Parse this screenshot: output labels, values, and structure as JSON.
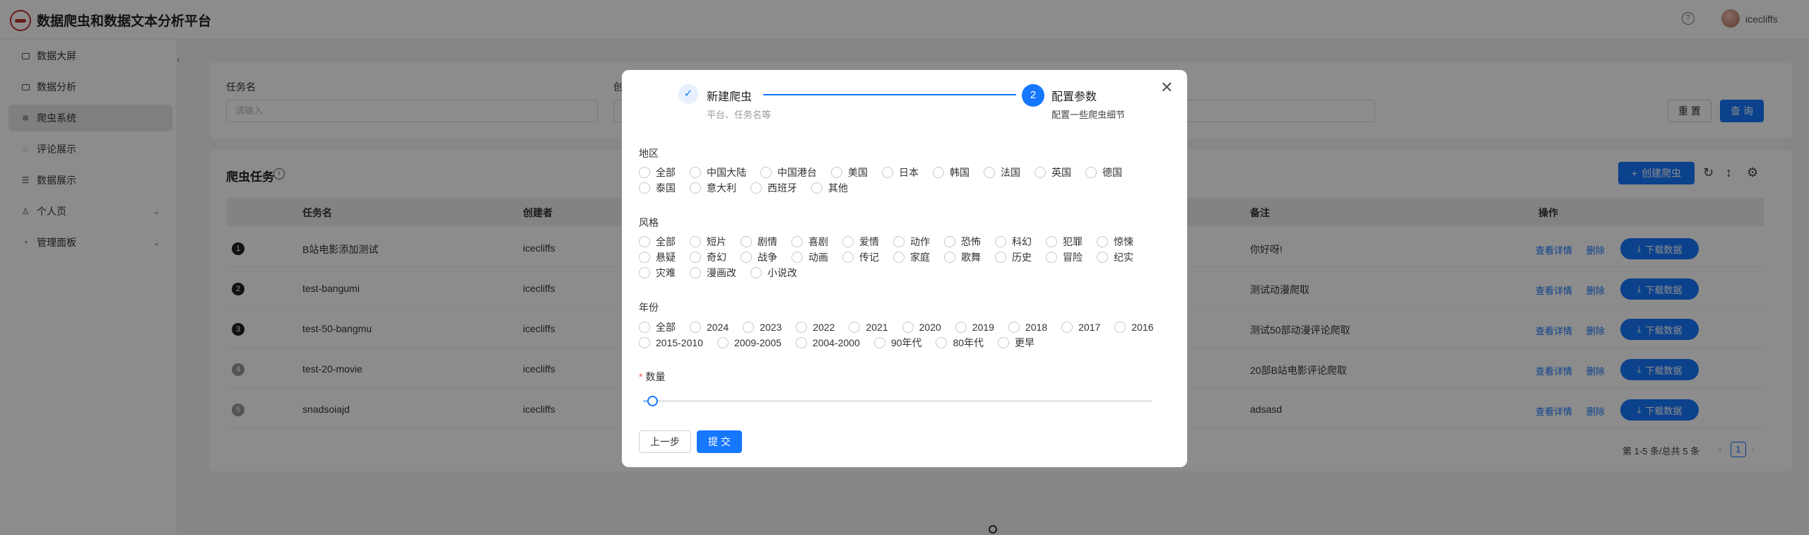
{
  "header": {
    "title": "数据爬虫和数据文本分析平台",
    "help_icon": "question-circle-icon",
    "user": "icecliffs"
  },
  "sidebar": {
    "collapse_icon": "chevron-left-icon",
    "items": [
      {
        "label": "数据大屏",
        "icon": "monitor-icon"
      },
      {
        "label": "数据分析",
        "icon": "monitor-icon"
      },
      {
        "label": "爬虫系统",
        "icon": "bug-icon",
        "active": true
      },
      {
        "label": "评论展示",
        "icon": "comment-icon"
      },
      {
        "label": "数据展示",
        "icon": "table-icon"
      },
      {
        "label": "个人页",
        "icon": "user-icon"
      },
      {
        "label": "管理面板",
        "icon": "dashboard-icon"
      }
    ]
  },
  "search": {
    "task_label": "任务名",
    "task_placeholder": "请输入",
    "second_label": "创",
    "reset": "重 置",
    "query": "查 询"
  },
  "table": {
    "title": "爬虫任务",
    "create_button": "创建爬虫",
    "columns": [
      "任务名",
      "创建者",
      "备注",
      "操作"
    ],
    "rows": [
      {
        "index": "1",
        "name": "B站电影添加测试",
        "creator": "icecliffs",
        "note": "你好呀!"
      },
      {
        "index": "2",
        "name": "test-bangumi",
        "creator": "icecliffs",
        "note": "测试动漫爬取"
      },
      {
        "index": "3",
        "name": "test-50-bangmu",
        "creator": "icecliffs",
        "note": "测试50部动漫评论爬取"
      },
      {
        "index": "4",
        "name": "test-20-movie",
        "creator": "icecliffs",
        "note": "20部B站电影评论爬取"
      },
      {
        "index": "5",
        "name": "snadsoiajd",
        "creator": "icecliffs",
        "note": "adsasd"
      }
    ],
    "actions": {
      "view": "查看详情",
      "delete": "删除",
      "download": "下载数据"
    },
    "pagination": {
      "summary": "第 1-5 条/总共 5 条",
      "page": "1"
    }
  },
  "modal": {
    "steps": [
      {
        "title": "新建爬虫",
        "desc": "平台、任务名等"
      },
      {
        "number": "2",
        "title": "配置参数",
        "desc": "配置一些爬虫细节"
      }
    ],
    "region": {
      "label": "地区",
      "options": [
        "全部",
        "中国大陆",
        "中国港台",
        "美国",
        "日本",
        "韩国",
        "法国",
        "英国",
        "德国",
        "泰国",
        "意大利",
        "西班牙",
        "其他"
      ]
    },
    "style": {
      "label": "风格",
      "options": [
        "全部",
        "短片",
        "剧情",
        "喜剧",
        "爱情",
        "动作",
        "恐怖",
        "科幻",
        "犯罪",
        "惊悚",
        "悬疑",
        "奇幻",
        "战争",
        "动画",
        "传记",
        "家庭",
        "歌舞",
        "历史",
        "冒险",
        "纪实",
        "灾难",
        "漫画改",
        "小说改"
      ]
    },
    "year": {
      "label": "年份",
      "options": [
        "全部",
        "2024",
        "2023",
        "2022",
        "2021",
        "2020",
        "2019",
        "2018",
        "2017",
        "2016",
        "2015-2010",
        "2009-2005",
        "2004-2000",
        "90年代",
        "80年代",
        "更早"
      ]
    },
    "quantity": {
      "label": "数量",
      "required_mark": "*",
      "value_fraction": 0.01
    },
    "prev_button": "上一步",
    "submit_button": "提 交"
  }
}
